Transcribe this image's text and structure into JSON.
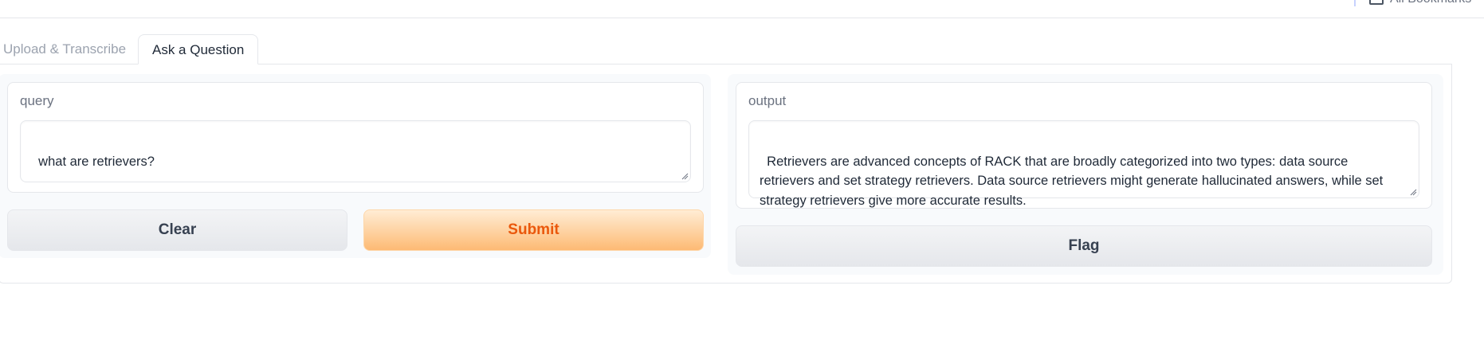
{
  "browser": {
    "bookmarks_folder_label": "All Bookmarks"
  },
  "tabs": [
    {
      "label": "Upload & Transcribe",
      "active": false
    },
    {
      "label": "Ask a Question",
      "active": true
    }
  ],
  "query": {
    "label": "query",
    "value": "what are retrievers?"
  },
  "output": {
    "label": "output",
    "value": "Retrievers are advanced concepts of RACK that are broadly categorized into two types: data source retrievers and set strategy retrievers. Data source retrievers might generate hallucinated answers, while set strategy retrievers give more accurate results."
  },
  "buttons": {
    "clear": "Clear",
    "submit": "Submit",
    "flag": "Flag"
  },
  "colors": {
    "accent": "#ea580c",
    "submit_gradient_top": "#ffedd5",
    "submit_gradient_bottom": "#fdba74"
  }
}
